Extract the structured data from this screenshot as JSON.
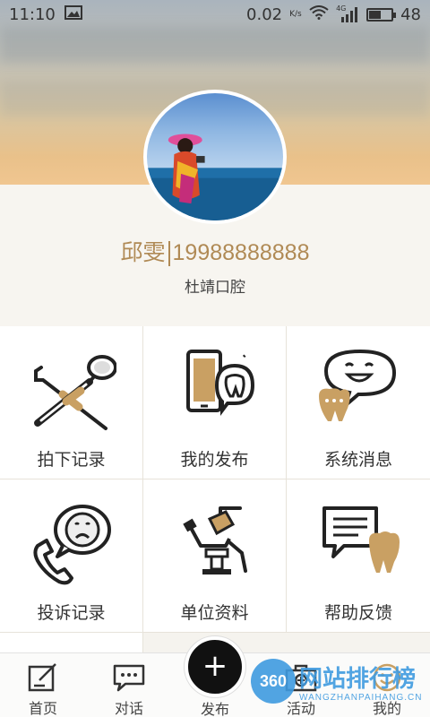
{
  "status_bar": {
    "time": "11:10",
    "speed": "0.02",
    "speed_unit": "K/s",
    "network": "4G",
    "battery": "48",
    "battery_level": 0.48
  },
  "profile": {
    "name": "邱雯",
    "phone": "19988888888",
    "clinic": "杜靖口腔"
  },
  "menu": [
    {
      "label": "拍下记录",
      "icon": "dental-mirror-icon"
    },
    {
      "label": "我的发布",
      "icon": "phone-tooth-icon"
    },
    {
      "label": "系统消息",
      "icon": "chat-smile-tooth-icon"
    },
    {
      "label": "投诉记录",
      "icon": "phone-sad-face-icon"
    },
    {
      "label": "单位资料",
      "icon": "dental-chair-icon"
    },
    {
      "label": "帮助反馈",
      "icon": "message-tooth-icon"
    }
  ],
  "tabbar": {
    "home": "首页",
    "chat": "对话",
    "publish": "发布",
    "publish_symbol": "+",
    "activity": "活动",
    "mine": "我的"
  },
  "watermark": {
    "badge": "360",
    "text": "网站排行榜",
    "sub": "WANGZHANPAIHANG.CN"
  },
  "colors": {
    "accent": "#b08a55",
    "tooth": "#c9a063",
    "dark": "#222222"
  }
}
